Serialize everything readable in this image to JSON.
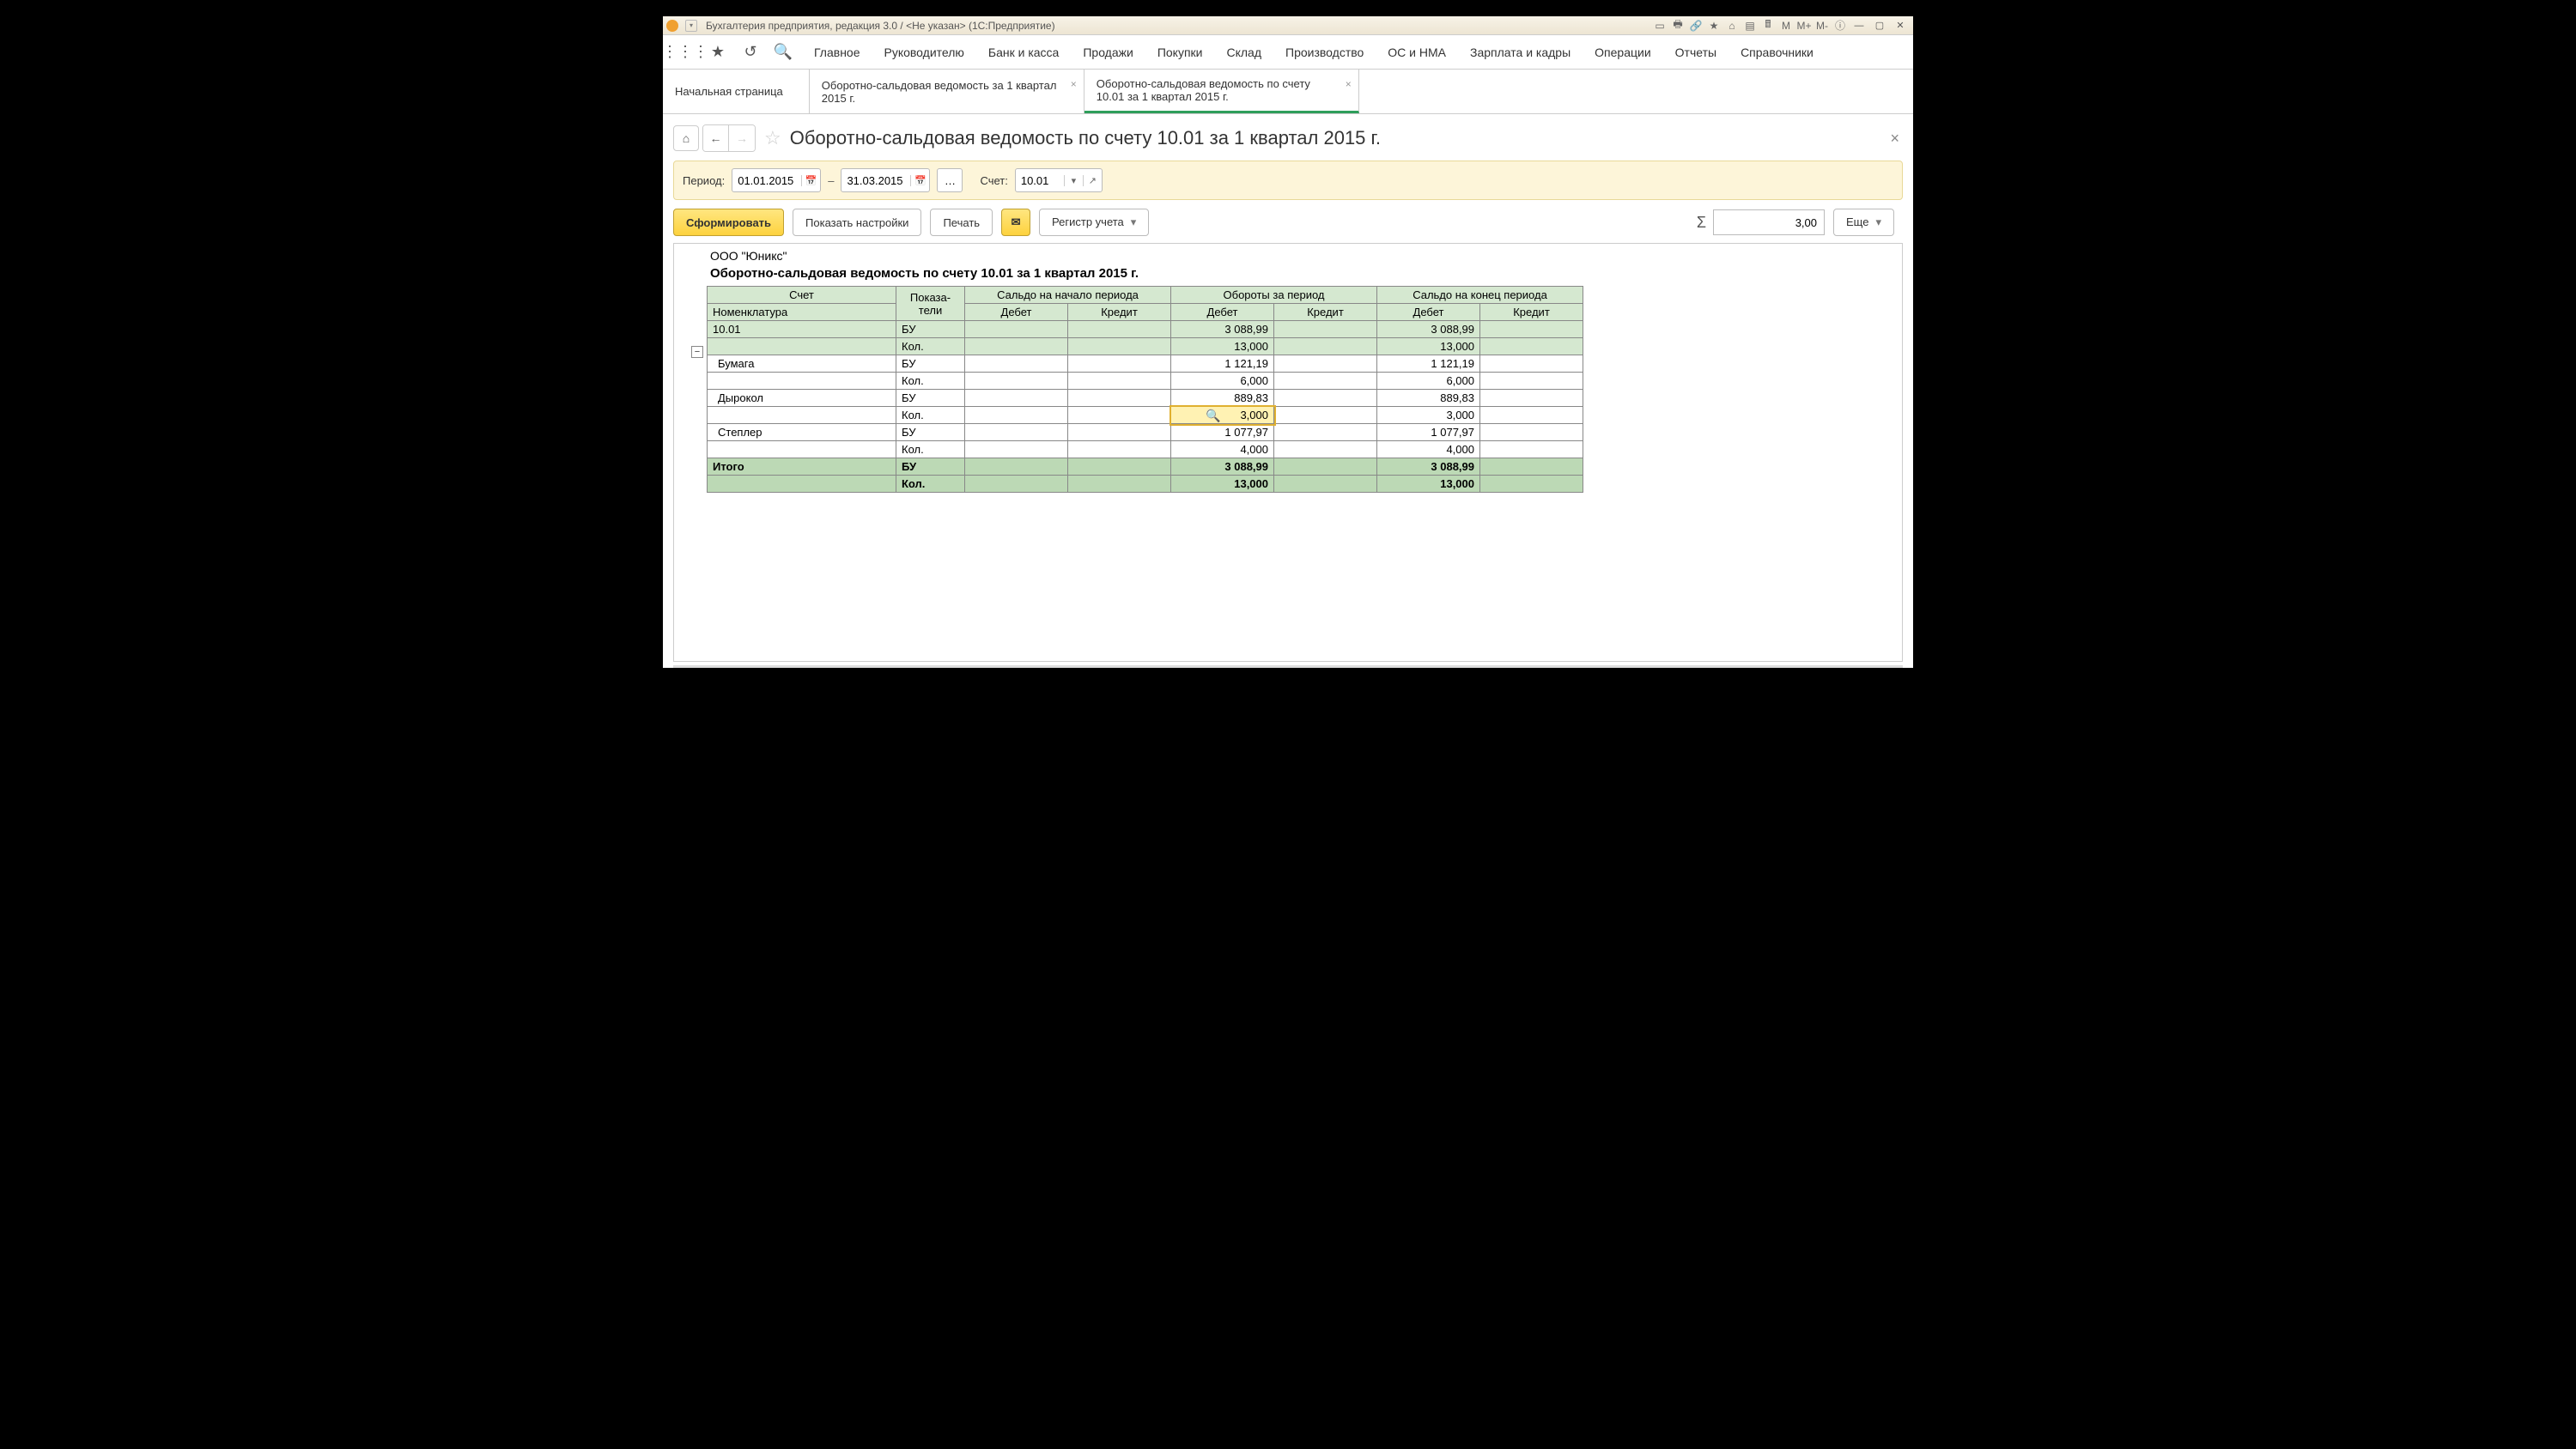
{
  "window_title": "Бухгалтерия предприятия, редакция 3.0 / <Не указан> (1С:Предприятие)",
  "nav": [
    "Главное",
    "Руководителю",
    "Банк и касса",
    "Продажи",
    "Покупки",
    "Склад",
    "Производство",
    "ОС и НМА",
    "Зарплата и кадры",
    "Операции",
    "Отчеты",
    "Справочники"
  ],
  "tabs": {
    "home": "Начальная страница",
    "t1": "Оборотно-сальдовая ведомость за 1 квартал 2015 г.",
    "t2": "Оборотно-сальдовая ведомость по счету 10.01 за 1 квартал 2015 г."
  },
  "page_title": "Оборотно-сальдовая ведомость по счету 10.01 за 1 квартал 2015 г.",
  "period": {
    "label": "Период:",
    "from": "01.01.2015",
    "to": "31.03.2015",
    "dash": "–"
  },
  "account": {
    "label": "Счет:",
    "value": "10.01"
  },
  "buttons": {
    "form": "Сформировать",
    "settings": "Показать настройки",
    "print": "Печать",
    "register": "Регистр учета",
    "more": "Еще"
  },
  "sum_value": "3,00",
  "company": "ООО \"Юникс\"",
  "report_title": "Оборотно-сальдовая ведомость по счету 10.01 за 1 квартал 2015 г.",
  "headers": {
    "acct": "Счет",
    "nomen": "Номенклатура",
    "ind": "Показа-\nтели",
    "start": "Сальдо на начало периода",
    "turn": "Обороты за период",
    "end": "Сальдо на конец периода",
    "debit": "Дебет",
    "credit": "Кредит"
  },
  "ind": {
    "bu": "БУ",
    "kol": "Кол."
  },
  "rows": {
    "r1001": {
      "name": "10.01",
      "debit_turn": "3 088,99",
      "debit_end": "3 088,99",
      "kol_turn": "13,000",
      "kol_end": "13,000"
    },
    "bumaga": {
      "name": "Бумага",
      "debit_turn": "1 121,19",
      "debit_end": "1 121,19",
      "kol_turn": "6,000",
      "kol_end": "6,000"
    },
    "dyrokol": {
      "name": "Дырокол",
      "debit_turn": "889,83",
      "debit_end": "889,83",
      "kol_turn": "3,000",
      "kol_end": "3,000"
    },
    "stepler": {
      "name": "Степлер",
      "debit_turn": "1 077,97",
      "debit_end": "1 077,97",
      "kol_turn": "4,000",
      "kol_end": "4,000"
    },
    "total": {
      "name": "Итого",
      "debit_turn": "3 088,99",
      "debit_end": "3 088,99",
      "kol_turn": "13,000",
      "kol_end": "13,000"
    }
  },
  "sys_labels": {
    "m": "М",
    "mplus": "М+",
    "mminus": "М-"
  }
}
